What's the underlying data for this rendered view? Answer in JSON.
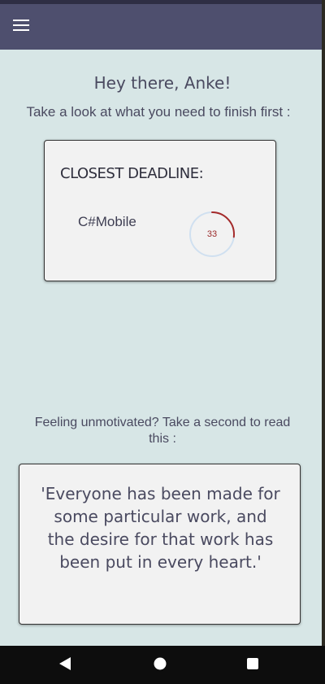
{
  "header": {
    "menu_icon": "hamburger-menu-icon",
    "bar_color": "#4e4f6e"
  },
  "greeting": {
    "title": "Hey there, Anke!",
    "subtitle": "Take a look at what you need to finish first :"
  },
  "deadline_card": {
    "title": "CLOSEST DEADLINE:",
    "course": "C#Mobile",
    "days_left": "33",
    "ring_fraction": 0.27,
    "ring_color": "#a52a2a",
    "ring_track_color": "#d0e0f0"
  },
  "motivation": {
    "prompt": "Feeling unmotivated? Take a second to read this :",
    "quote": "'Everyone has been made for some particular work, and the desire for that work has been put in every heart.'"
  },
  "nav": {
    "back_icon": "back-triangle-icon",
    "home_icon": "home-circle-icon",
    "recents_icon": "recents-square-icon"
  }
}
